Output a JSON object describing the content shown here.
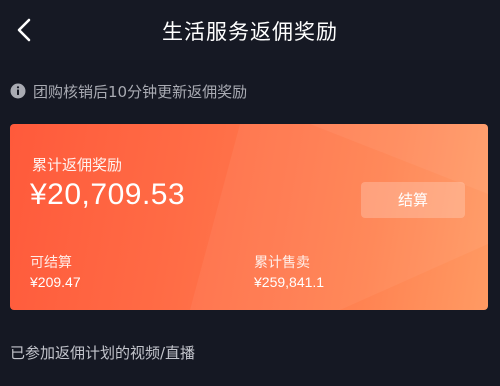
{
  "header": {
    "title": "生活服务返佣奖励"
  },
  "notice": {
    "text": "团购核销后10分钟更新返佣奖励"
  },
  "reward_card": {
    "label": "累计返佣奖励",
    "amount": "¥20,709.53",
    "settle_button_label": "结算",
    "settleable_label": "可结算",
    "settleable_value": "¥209.47",
    "total_sales_label": "累计售卖",
    "total_sales_value": "¥259,841.1"
  },
  "section": {
    "participating_label": "已参加返佣计划的视频/直播"
  },
  "colors": {
    "background": "#151823",
    "card_gradient_start": "#ff5a3b",
    "card_gradient_end": "#ff9a63"
  },
  "icons": {
    "back": "chevron-left-icon",
    "notice": "info-icon"
  }
}
